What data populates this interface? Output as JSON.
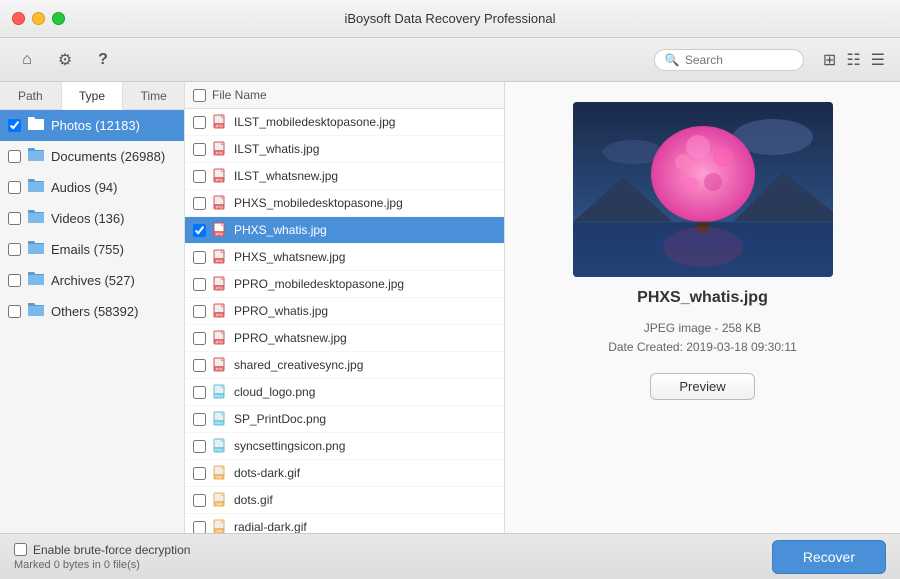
{
  "app": {
    "title": "iBoysoft Data Recovery Professional"
  },
  "toolbar": {
    "search_placeholder": "Search",
    "home_icon": "⌂",
    "settings_icon": "⚙",
    "help_icon": "?",
    "grid_icon": "▦",
    "columns_icon": "☰",
    "list_icon": "≡"
  },
  "tabs": [
    {
      "id": "path",
      "label": "Path",
      "active": false
    },
    {
      "id": "type",
      "label": "Type",
      "active": true
    },
    {
      "id": "time",
      "label": "Time",
      "active": false
    }
  ],
  "sidebar": {
    "items": [
      {
        "label": "Photos (12183)",
        "icon": "📁",
        "selected": true,
        "color": "#5b9bd5"
      },
      {
        "label": "Documents (26988)",
        "icon": "📁",
        "selected": false,
        "color": "#5b9bd5"
      },
      {
        "label": "Audios (94)",
        "icon": "📁",
        "selected": false,
        "color": "#5b9bd5"
      },
      {
        "label": "Videos (136)",
        "icon": "📁",
        "selected": false,
        "color": "#5b9bd5"
      },
      {
        "label": "Emails (755)",
        "icon": "📁",
        "selected": false,
        "color": "#5b9bd5"
      },
      {
        "label": "Archives (527)",
        "icon": "📁",
        "selected": false,
        "color": "#5b9bd5"
      },
      {
        "label": "Others (58392)",
        "icon": "📁",
        "selected": false,
        "color": "#5b9bd5"
      }
    ]
  },
  "file_list": {
    "header": "File Name",
    "files": [
      {
        "name": "ILST_mobiledesktopasone.jpg",
        "type": "jpg",
        "selected": false
      },
      {
        "name": "ILST_whatis.jpg",
        "type": "jpg",
        "selected": false
      },
      {
        "name": "ILST_whatsnew.jpg",
        "type": "jpg",
        "selected": false
      },
      {
        "name": "PHXS_mobiledesktopasone.jpg",
        "type": "jpg",
        "selected": false
      },
      {
        "name": "PHXS_whatis.jpg",
        "type": "jpg",
        "selected": true
      },
      {
        "name": "PHXS_whatsnew.jpg",
        "type": "jpg",
        "selected": false
      },
      {
        "name": "PPRO_mobiledesktopasone.jpg",
        "type": "jpg",
        "selected": false
      },
      {
        "name": "PPRO_whatis.jpg",
        "type": "jpg",
        "selected": false
      },
      {
        "name": "PPRO_whatsnew.jpg",
        "type": "jpg",
        "selected": false
      },
      {
        "name": "shared_creativesync.jpg",
        "type": "jpg",
        "selected": false
      },
      {
        "name": "cloud_logo.png",
        "type": "png",
        "selected": false
      },
      {
        "name": "SP_PrintDoc.png",
        "type": "png",
        "selected": false
      },
      {
        "name": "syncsettingsicon.png",
        "type": "png",
        "selected": false
      },
      {
        "name": "dots-dark.gif",
        "type": "gif",
        "selected": false
      },
      {
        "name": "dots.gif",
        "type": "gif",
        "selected": false
      },
      {
        "name": "radial-dark.gif",
        "type": "gif",
        "selected": false
      }
    ]
  },
  "preview": {
    "filename": "PHXS_whatis.jpg",
    "meta_line1": "JPEG image - 258 KB",
    "meta_line2": "Date Created: 2019-03-18 09:30:11",
    "preview_button": "Preview"
  },
  "bottom": {
    "checkbox_label": "Enable brute-force decryption",
    "status": "Marked 0 bytes in 0 file(s)",
    "recover_button": "Recover"
  }
}
